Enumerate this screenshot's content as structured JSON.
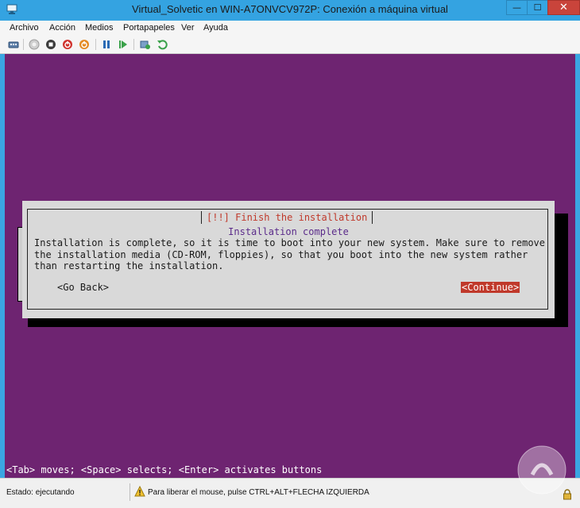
{
  "window": {
    "title": "Virtual_Solvetic en WIN-A7ONVCV972P: Conexión a máquina virtual",
    "minimize": "—",
    "maximize": "☐",
    "close": "✕"
  },
  "menu": {
    "items": [
      "Archivo",
      "Acción",
      "Medios",
      "Portapapeles",
      "Ver",
      "Ayuda"
    ]
  },
  "toolbar": {
    "icons": [
      "ctrl-alt-del-icon",
      "start-icon",
      "turn-off-icon",
      "shutdown-icon",
      "save-state-icon",
      "pause-icon",
      "resume-icon",
      "checkpoint-icon",
      "revert-icon"
    ]
  },
  "installer": {
    "dialog_title": "[!!] Finish the installation",
    "subtitle": "Installation complete",
    "message": "Installation is complete, so it is time to boot into your new system. Make sure to remove\nthe installation media (CD-ROM, floppies), so that you boot into the new system rather\nthan restarting the installation.",
    "go_back": "<Go Back>",
    "continue": "<Continue>",
    "help": "<Tab> moves; <Space> selects; <Enter> activates buttons"
  },
  "status": {
    "state": "Estado: ejecutando",
    "hint": "Para liberar el mouse, pulse CTRL+ALT+FLECHA IZQUIERDA"
  },
  "colors": {
    "vm_background": "#6e2471",
    "dialog_background": "#d9d9d9",
    "accent_red": "#c0392b",
    "title_bar": "#34a3e1"
  }
}
